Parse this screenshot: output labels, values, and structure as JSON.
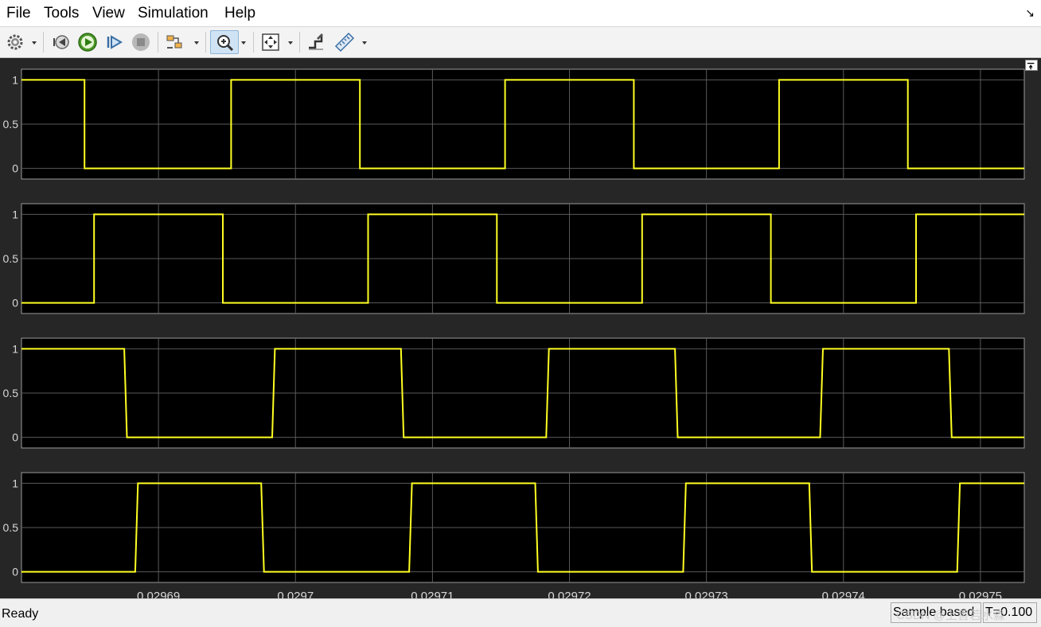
{
  "menu": [
    "File",
    "Tools",
    "View",
    "Simulation",
    "Help"
  ],
  "toolbar": {
    "buttons": [
      {
        "name": "settings-icon",
        "dropdown": true
      },
      {
        "name": "step-back-icon",
        "dropdown": false
      },
      {
        "name": "run-icon",
        "dropdown": false
      },
      {
        "name": "step-forward-icon",
        "dropdown": false
      },
      {
        "name": "stop-icon",
        "dropdown": false
      },
      {
        "name": "highlight-block-icon",
        "dropdown": true
      },
      {
        "name": "zoom-in-icon",
        "dropdown": true,
        "active": true
      },
      {
        "name": "autoscale-icon",
        "dropdown": true
      },
      {
        "name": "style-icon",
        "dropdown": false
      },
      {
        "name": "measurements-icon",
        "dropdown": true
      }
    ]
  },
  "scope": {
    "background": "#000000",
    "frame_bg": "#262626",
    "grid_color": "#5a5a5a",
    "line_color": "#ffff22"
  },
  "chart_data": [
    {
      "type": "line",
      "ylim": [
        -0.12,
        1.12
      ],
      "yticks": [
        "1",
        "0.5",
        "0"
      ],
      "xlim": [
        0.02968,
        0.0297532
      ],
      "series": [
        {
          "x": [
            0.02968,
            0.0296846,
            0.0296846,
            0.0296953,
            0.0296953,
            0.0297047,
            0.0297047,
            0.0297153,
            0.0297153,
            0.0297247,
            0.0297247,
            0.0297353,
            0.0297353,
            0.0297447,
            0.0297447,
            0.0297532
          ],
          "y": [
            1,
            1,
            0,
            0,
            1,
            1,
            0,
            0,
            1,
            1,
            0,
            0,
            1,
            1,
            0,
            0
          ]
        }
      ]
    },
    {
      "type": "line",
      "ylim": [
        -0.12,
        1.12
      ],
      "yticks": [
        "1",
        "0.5",
        "0"
      ],
      "xlim": [
        0.02968,
        0.0297532
      ],
      "series": [
        {
          "x": [
            0.02968,
            0.0296853,
            0.0296853,
            0.0296947,
            0.0296947,
            0.0297053,
            0.0297053,
            0.0297147,
            0.0297147,
            0.0297253,
            0.0297253,
            0.0297347,
            0.0297347,
            0.0297453,
            0.0297453,
            0.0297532
          ],
          "y": [
            0,
            0,
            1,
            1,
            0,
            0,
            1,
            1,
            0,
            0,
            1,
            1,
            0,
            0,
            1,
            1
          ]
        }
      ]
    },
    {
      "type": "line",
      "ylim": [
        -0.12,
        1.12
      ],
      "yticks": [
        "1",
        "0.5",
        "0"
      ],
      "xlim": [
        0.02968,
        0.0297532
      ],
      "series": [
        {
          "x": [
            0.02968,
            0.0296875,
            0.0296877,
            0.0296983,
            0.0296985,
            0.0297077,
            0.0297079,
            0.0297183,
            0.0297185,
            0.0297277,
            0.0297279,
            0.0297383,
            0.0297385,
            0.0297477,
            0.0297479,
            0.0297532
          ],
          "y": [
            1,
            1,
            0,
            0,
            1,
            1,
            0,
            0,
            1,
            1,
            0,
            0,
            1,
            1,
            0,
            0
          ]
        }
      ]
    },
    {
      "type": "line",
      "ylim": [
        -0.12,
        1.12
      ],
      "yticks": [
        "1",
        "0.5",
        "0"
      ],
      "xlim": [
        0.02968,
        0.0297532
      ],
      "xticks": [
        "0.02969",
        "0.0297",
        "0.02971",
        "0.02972",
        "0.02973",
        "0.02974",
        "0.02975"
      ],
      "xtick_values": [
        0.02969,
        0.0297,
        0.02971,
        0.02972,
        0.02973,
        0.02974,
        0.02975
      ],
      "series": [
        {
          "x": [
            0.02968,
            0.0296883,
            0.0296885,
            0.0296975,
            0.0296977,
            0.0297083,
            0.0297085,
            0.0297175,
            0.0297177,
            0.0297283,
            0.0297285,
            0.0297375,
            0.0297377,
            0.0297483,
            0.0297485,
            0.0297532
          ],
          "y": [
            0,
            0,
            1,
            1,
            0,
            0,
            1,
            1,
            0,
            0,
            1,
            1,
            0,
            0,
            1,
            1
          ]
        }
      ]
    }
  ],
  "status": {
    "ready": "Ready",
    "sample_based": "Sample based",
    "time": "T=0.100"
  },
  "watermark": "CSDN @上善若水淼"
}
